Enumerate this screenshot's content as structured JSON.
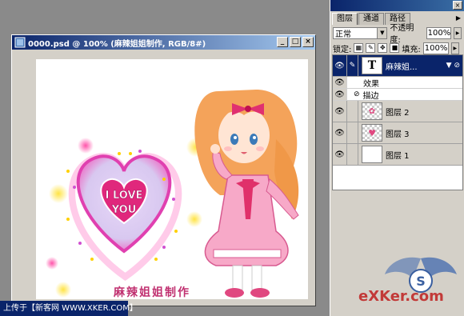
{
  "document": {
    "title": "0000.psd @ 100% (麻辣姐姐制作, RGB/8#)",
    "controls": {
      "minimize": "_",
      "maximize": "□",
      "close": "×"
    }
  },
  "artwork": {
    "heart_text_line1": "I LOVE",
    "heart_text_line2": "YOU",
    "signature": "麻辣姐姐制作"
  },
  "layers_panel": {
    "tabs": [
      "图层",
      "通道",
      "路径"
    ],
    "blend_mode": "正常",
    "opacity_label": "不透明度:",
    "opacity_value": "100%",
    "lock_label": "锁定:",
    "fill_label": "填充:",
    "fill_value": "100%",
    "layers": [
      {
        "name": "麻辣姐...",
        "type": "text",
        "thumb": "T",
        "selected": true
      },
      {
        "name": "效果",
        "type": "effect-group"
      },
      {
        "name": "描边",
        "type": "effect"
      },
      {
        "name": "图层 2",
        "type": "pixel"
      },
      {
        "name": "图层 3",
        "type": "pixel"
      },
      {
        "name": "图层 1",
        "type": "pixel"
      }
    ]
  },
  "footer": {
    "text": "上传于【新客网 WWW.XKER.COM】"
  },
  "watermark": {
    "text": "eXKer.com"
  },
  "colors": {
    "accent": "#0a246a",
    "pink": "#f06ab4",
    "magenta": "#d81b8a"
  }
}
